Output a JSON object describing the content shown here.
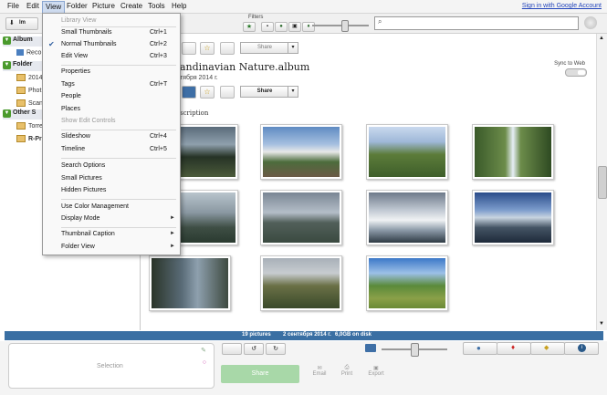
{
  "menubar": {
    "items": [
      "File",
      "Edit",
      "View",
      "Folder",
      "Picture",
      "Create",
      "Tools",
      "Help"
    ],
    "signin": "Sign in with Google Account"
  },
  "toolbar": {
    "filters_label": "Filters"
  },
  "sidebar": {
    "headers": [
      "Album",
      "Folder",
      "Other S"
    ],
    "items": [
      "Reco",
      "2014",
      "Phot",
      "Scan",
      "Torre",
      "R-Pr"
    ],
    "import_label": "Im"
  },
  "view_menu": {
    "items": [
      {
        "label": "Library View",
        "shortcut": "",
        "disabled": true
      },
      {
        "label": "Small Thumbnails",
        "shortcut": "Ctrl+1"
      },
      {
        "label": "Normal Thumbnails",
        "shortcut": "Ctrl+2",
        "checked": true
      },
      {
        "label": "Edit View",
        "shortcut": "Ctrl+3"
      },
      {
        "label": "Properties",
        "shortcut": ""
      },
      {
        "label": "Tags",
        "shortcut": "Ctrl+T"
      },
      {
        "label": "People",
        "shortcut": ""
      },
      {
        "label": "Places",
        "shortcut": ""
      },
      {
        "label": "Show Edit Controls",
        "shortcut": "",
        "disabled": true
      },
      {
        "label": "Slideshow",
        "shortcut": "Ctrl+4"
      },
      {
        "label": "Timeline",
        "shortcut": "Ctrl+5"
      },
      {
        "label": "Search Options",
        "shortcut": ""
      },
      {
        "label": "Small Pictures",
        "shortcut": ""
      },
      {
        "label": "Hidden Pictures",
        "shortcut": ""
      },
      {
        "label": "Use Color Management",
        "shortcut": ""
      },
      {
        "label": "Display Mode",
        "shortcut": "",
        "submenu": true
      },
      {
        "label": "Thumbnail Caption",
        "shortcut": "",
        "submenu": true
      },
      {
        "label": "Folder View",
        "shortcut": "",
        "submenu": true
      }
    ]
  },
  "album": {
    "title": "andinavian Nature.album",
    "date": "тября 2014 г.",
    "description_label": "scription",
    "share_label": "Share",
    "sync_label": "Sync to Web"
  },
  "status": {
    "count": "19 pictures",
    "date": "2 сентября 2014 г.",
    "size": "6,0GB on disk"
  },
  "bottom": {
    "selection_label": "Selection",
    "share_label": "Share",
    "email_label": "Email",
    "print_label": "Print",
    "export_label": "Export"
  },
  "colors": {
    "accent": "#3a6fa3",
    "share_green": "#a8d8a8"
  }
}
